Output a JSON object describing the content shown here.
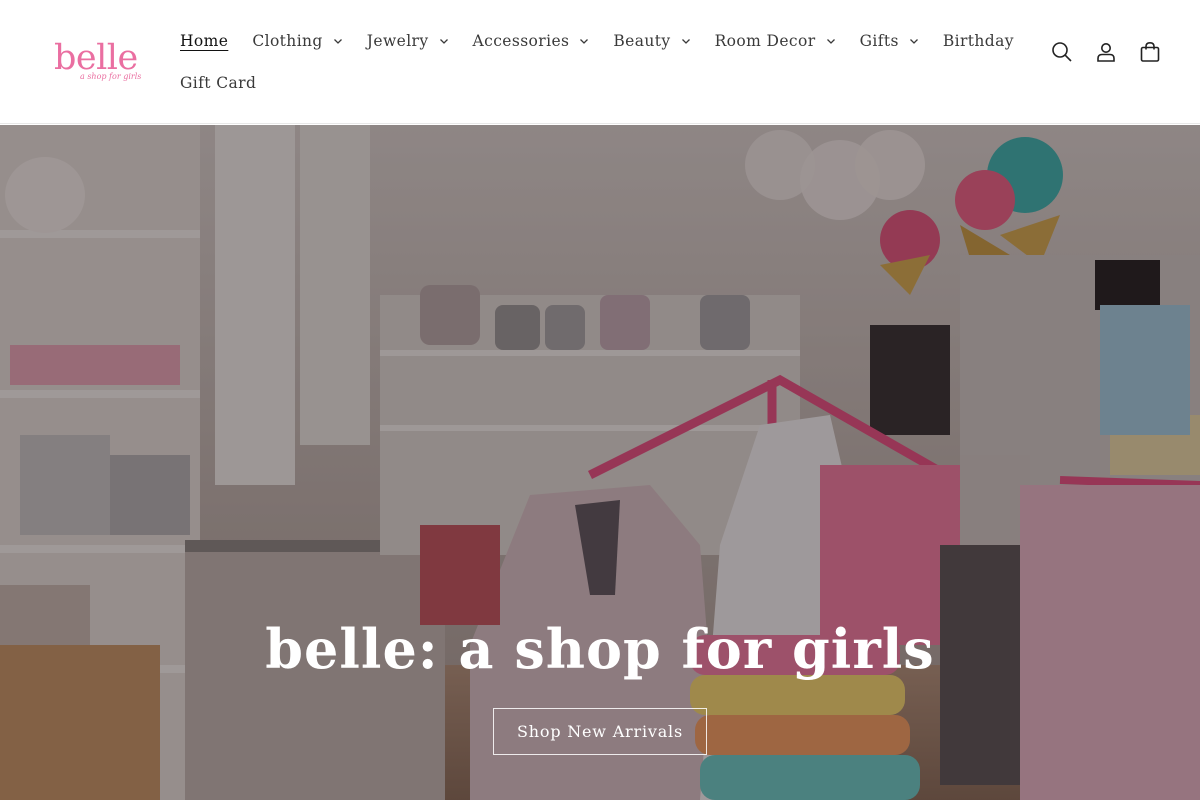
{
  "brand": {
    "logo_text": "belle",
    "logo_tagline": "a shop for girls",
    "logo_color": "#ea6fa1"
  },
  "nav": {
    "items": [
      {
        "label": "Home",
        "has_dropdown": false,
        "active": true
      },
      {
        "label": "Clothing",
        "has_dropdown": true
      },
      {
        "label": "Jewelry",
        "has_dropdown": true
      },
      {
        "label": "Accessories",
        "has_dropdown": true
      },
      {
        "label": "Beauty",
        "has_dropdown": true
      },
      {
        "label": "Room Decor",
        "has_dropdown": true
      },
      {
        "label": "Gifts",
        "has_dropdown": true
      },
      {
        "label": "Birthday",
        "has_dropdown": false
      },
      {
        "label": "Gift Card",
        "has_dropdown": false
      }
    ]
  },
  "header_icons": [
    "search-icon",
    "account-icon",
    "cart-icon"
  ],
  "hero": {
    "title": "belle: a shop for girls",
    "button_label": "Shop New Arrivals",
    "image_description_icon": "store-interior-photo"
  }
}
